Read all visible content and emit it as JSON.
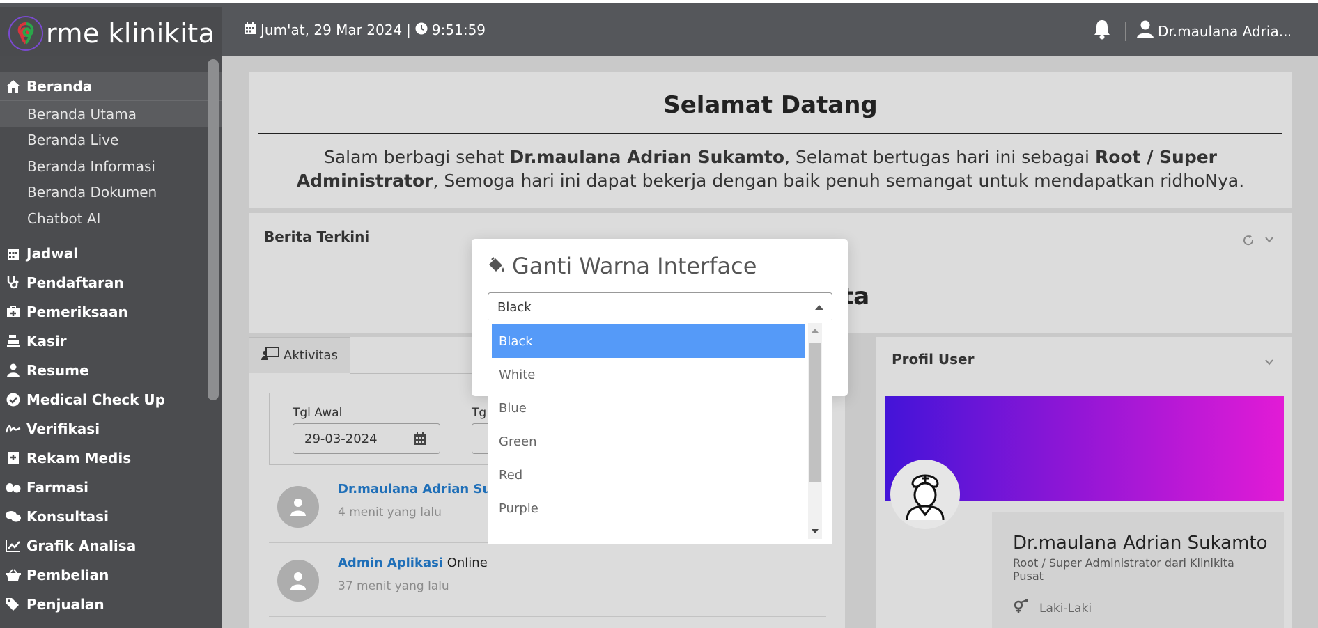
{
  "brand": {
    "name": "rme klinikita"
  },
  "header": {
    "date": "Jum'at, 29 Mar 2024",
    "separator": "|",
    "time": "9:51:59",
    "user": "Dr.maulana Adria..."
  },
  "sidebar": {
    "home": {
      "label": "Beranda",
      "sub": [
        "Beranda Utama",
        "Beranda Live",
        "Beranda Informasi",
        "Beranda Dokumen",
        "Chatbot AI"
      ]
    },
    "items": [
      {
        "label": "Jadwal",
        "icon": "calendar-icon"
      },
      {
        "label": "Pendaftaran",
        "icon": "stethoscope-icon"
      },
      {
        "label": "Pemeriksaan",
        "icon": "medkit-icon"
      },
      {
        "label": "Kasir",
        "icon": "cash-register-icon"
      },
      {
        "label": "Resume",
        "icon": "user-md-icon"
      },
      {
        "label": "Medical Check Up",
        "icon": "check-circle-icon"
      },
      {
        "label": "Verifikasi",
        "icon": "signature-icon"
      },
      {
        "label": "Rekam Medis",
        "icon": "book-medical-icon"
      },
      {
        "label": "Farmasi",
        "icon": "pills-icon"
      },
      {
        "label": "Konsultasi",
        "icon": "comments-icon"
      },
      {
        "label": "Grafik Analisa",
        "icon": "chart-line-icon"
      },
      {
        "label": "Pembelian",
        "icon": "basket-icon"
      },
      {
        "label": "Penjualan",
        "icon": "tags-icon"
      }
    ]
  },
  "welcome": {
    "title": "Selamat Datang",
    "text_1": "Salam berbagi sehat ",
    "name": "Dr.maulana Adrian Sukamto",
    "text_2": ", Selamat bertugas hari ini sebagai ",
    "role": "Root / Super Administrator",
    "text_3": ", Semoga hari ini dapat bekerja dengan baik penuh semangat untuk mendapatkan ridhoNya."
  },
  "berita": {
    "title": "Berita Terkini",
    "visible_text": "ta"
  },
  "aktivitas": {
    "tab_label": "Aktivitas",
    "filter": {
      "start_label": "Tgl Awal",
      "start_value": "29-03-2024",
      "end_label": "Tg"
    },
    "rows": [
      {
        "name": "Dr.maulana Adrian Sukam",
        "status": "",
        "time": "4 menit yang lalu"
      },
      {
        "name": "Admin Aplikasi",
        "status": " Online",
        "time": "37 menit yang lalu"
      }
    ]
  },
  "profil": {
    "title": "Profil User",
    "name": "Dr.maulana Adrian Sukamto",
    "role": "Root / Super Administrator dari Klinikita Pusat",
    "gender": "Laki-Laki"
  },
  "modal": {
    "title": "Ganti Warna Interface",
    "selected": "Black",
    "options": [
      "Black",
      "White",
      "Blue",
      "Green",
      "Red",
      "Purple"
    ]
  },
  "colors": {
    "topbar": "#55575b",
    "sidebar": "#4b4c4f",
    "accent_selected": "#559af8",
    "link": "#1f6fb8",
    "banner_start": "#4314d8",
    "banner_end": "#e21bd6"
  }
}
